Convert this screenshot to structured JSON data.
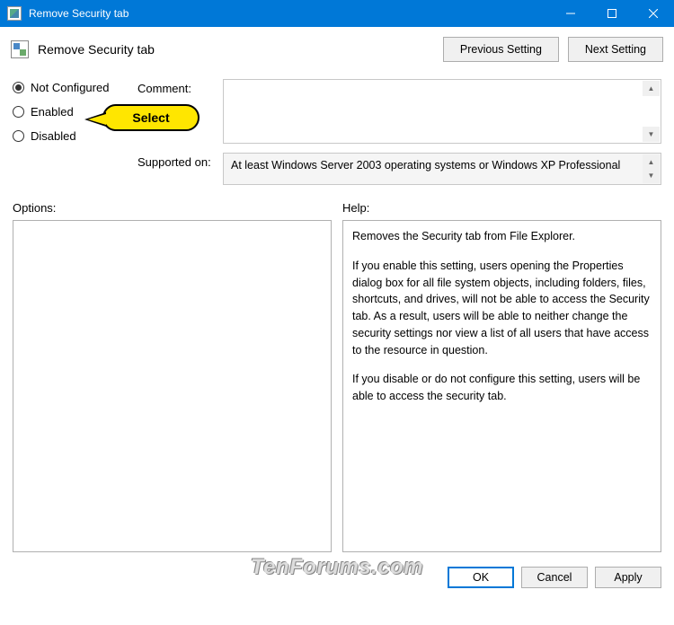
{
  "window": {
    "title": "Remove Security tab"
  },
  "toolbar": {
    "heading": "Remove Security tab",
    "prev_btn": "Previous Setting",
    "next_btn": "Next Setting"
  },
  "state": {
    "options": [
      {
        "label": "Not Configured",
        "selected": true
      },
      {
        "label": "Enabled",
        "selected": false
      },
      {
        "label": "Disabled",
        "selected": false
      }
    ],
    "callout_text": "Select"
  },
  "fields": {
    "comment_label": "Comment:",
    "comment_value": "",
    "supported_label": "Supported on:",
    "supported_value": "At least Windows Server 2003 operating systems or Windows XP Professional"
  },
  "lower": {
    "options_label": "Options:",
    "help_label": "Help:",
    "help_paragraphs": [
      "Removes the Security tab from File Explorer.",
      "If you enable this setting, users opening the Properties dialog box for all file system objects, including folders, files, shortcuts, and drives, will not be able to access the Security tab. As a result, users will be able to neither change the security settings nor view a list of all users that have access to the resource in question.",
      "If you disable or do not configure this setting, users will be able to access the security tab."
    ]
  },
  "footer": {
    "ok": "OK",
    "cancel": "Cancel",
    "apply": "Apply"
  },
  "watermark": "TenForums.com"
}
